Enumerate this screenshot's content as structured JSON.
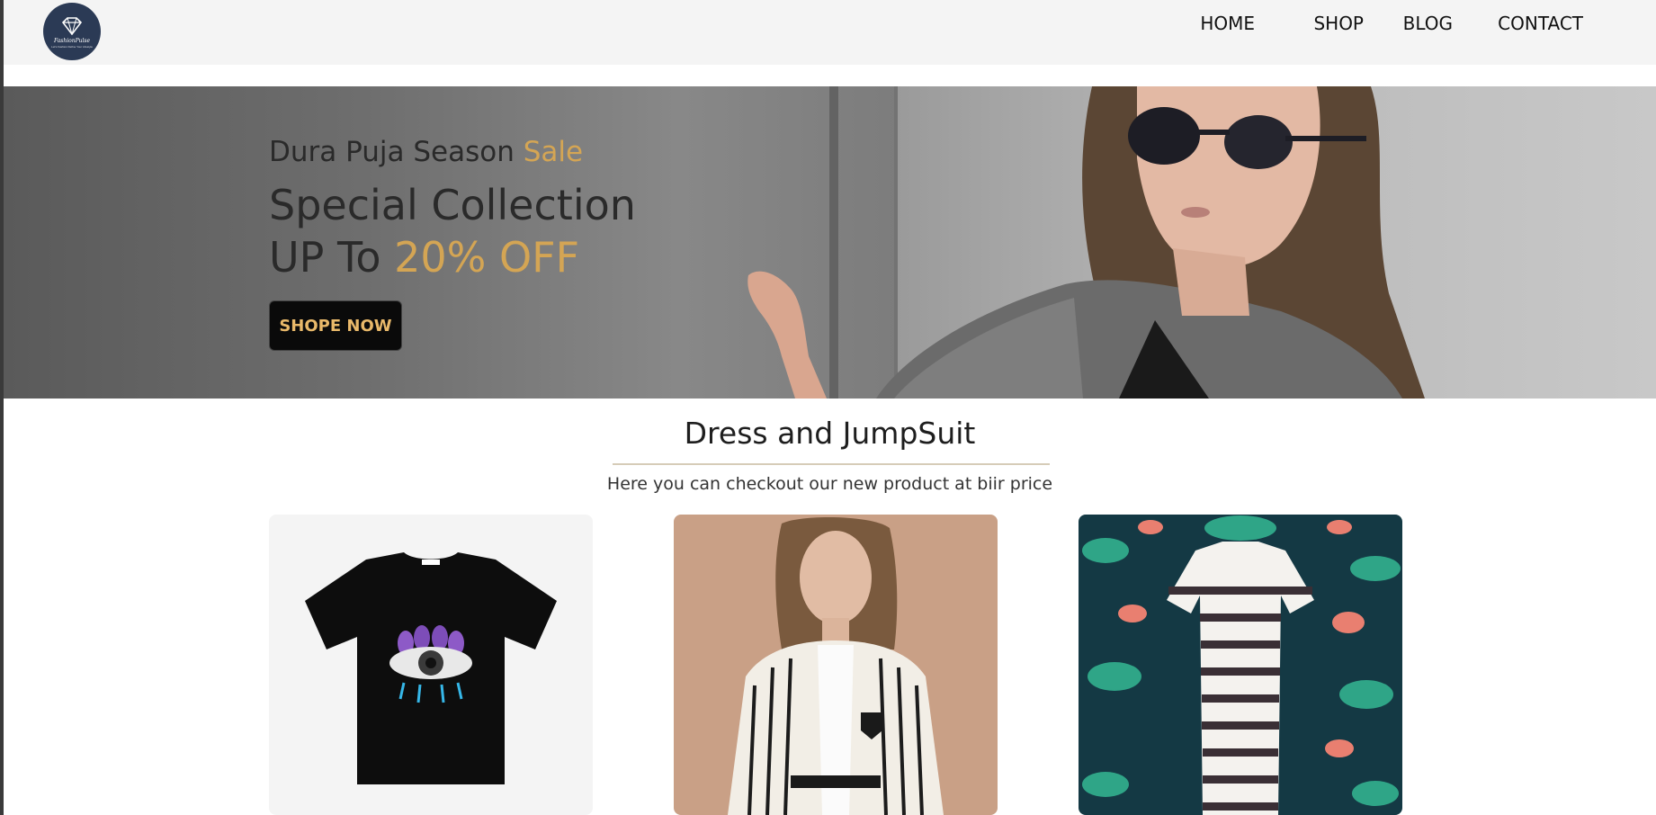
{
  "brand": {
    "name": "FashionPulse",
    "tagline": "Let's Fashion Define Your Lifestyle"
  },
  "nav": {
    "items": [
      {
        "label": "HOME"
      },
      {
        "label": "SHOP"
      },
      {
        "label": "BLOG"
      },
      {
        "label": "CONTACT"
      }
    ]
  },
  "hero": {
    "line1_prefix": "Dura Puja Season ",
    "line1_accent": "Sale",
    "line2": "Special Collection",
    "line3_prefix": "UP To ",
    "line3_accent": "20% OFF",
    "cta_label": "SHOPE NOW"
  },
  "section": {
    "title": "Dress and JumpSuit",
    "subtitle": "Here you can checkout our new product at biir price"
  },
  "colors": {
    "accent": "#d4a554",
    "logo_bg": "#2b3a55",
    "navbar_bg": "#f4f4f4"
  },
  "products": [
    {
      "icon": "black-tshirt-eye-print-image"
    },
    {
      "icon": "striped-blazer-model-image"
    },
    {
      "icon": "striped-dress-floral-background-image"
    }
  ]
}
